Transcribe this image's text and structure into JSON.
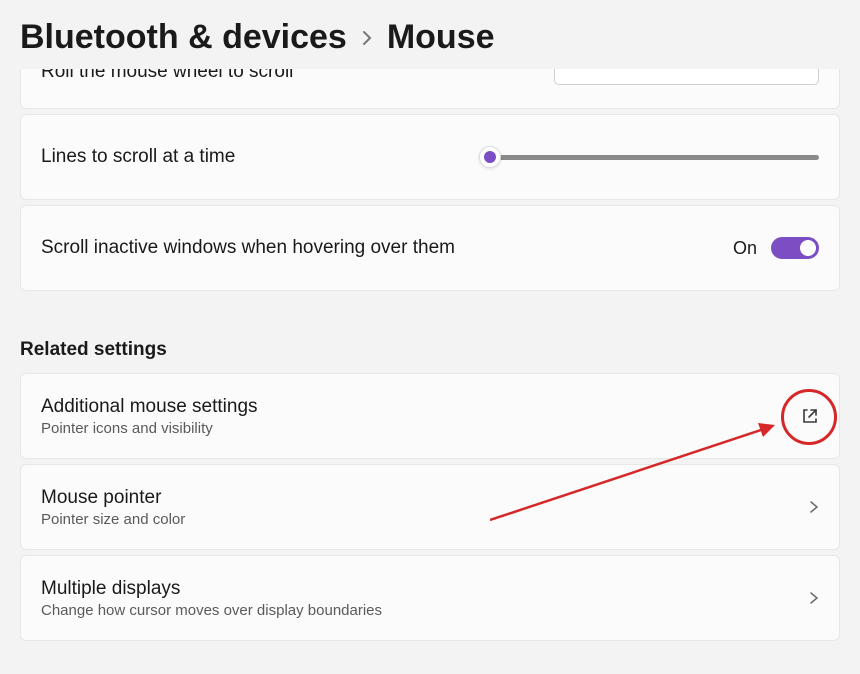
{
  "breadcrumb": {
    "parent": "Bluetooth & devices",
    "current": "Mouse"
  },
  "settings": {
    "scroll_wheel_label": "Roll the mouse wheel to scroll",
    "lines_label": "Lines to scroll at a time",
    "inactive_windows_label": "Scroll inactive windows when hovering over them",
    "inactive_windows_state": "On"
  },
  "related": {
    "title": "Related settings",
    "items": [
      {
        "title": "Additional mouse settings",
        "subtitle": "Pointer icons and visibility",
        "icon": "open-external"
      },
      {
        "title": "Mouse pointer",
        "subtitle": "Pointer size and color",
        "icon": "chevron"
      },
      {
        "title": "Multiple displays",
        "subtitle": "Change how cursor moves over display boundaries",
        "icon": "chevron"
      }
    ]
  }
}
